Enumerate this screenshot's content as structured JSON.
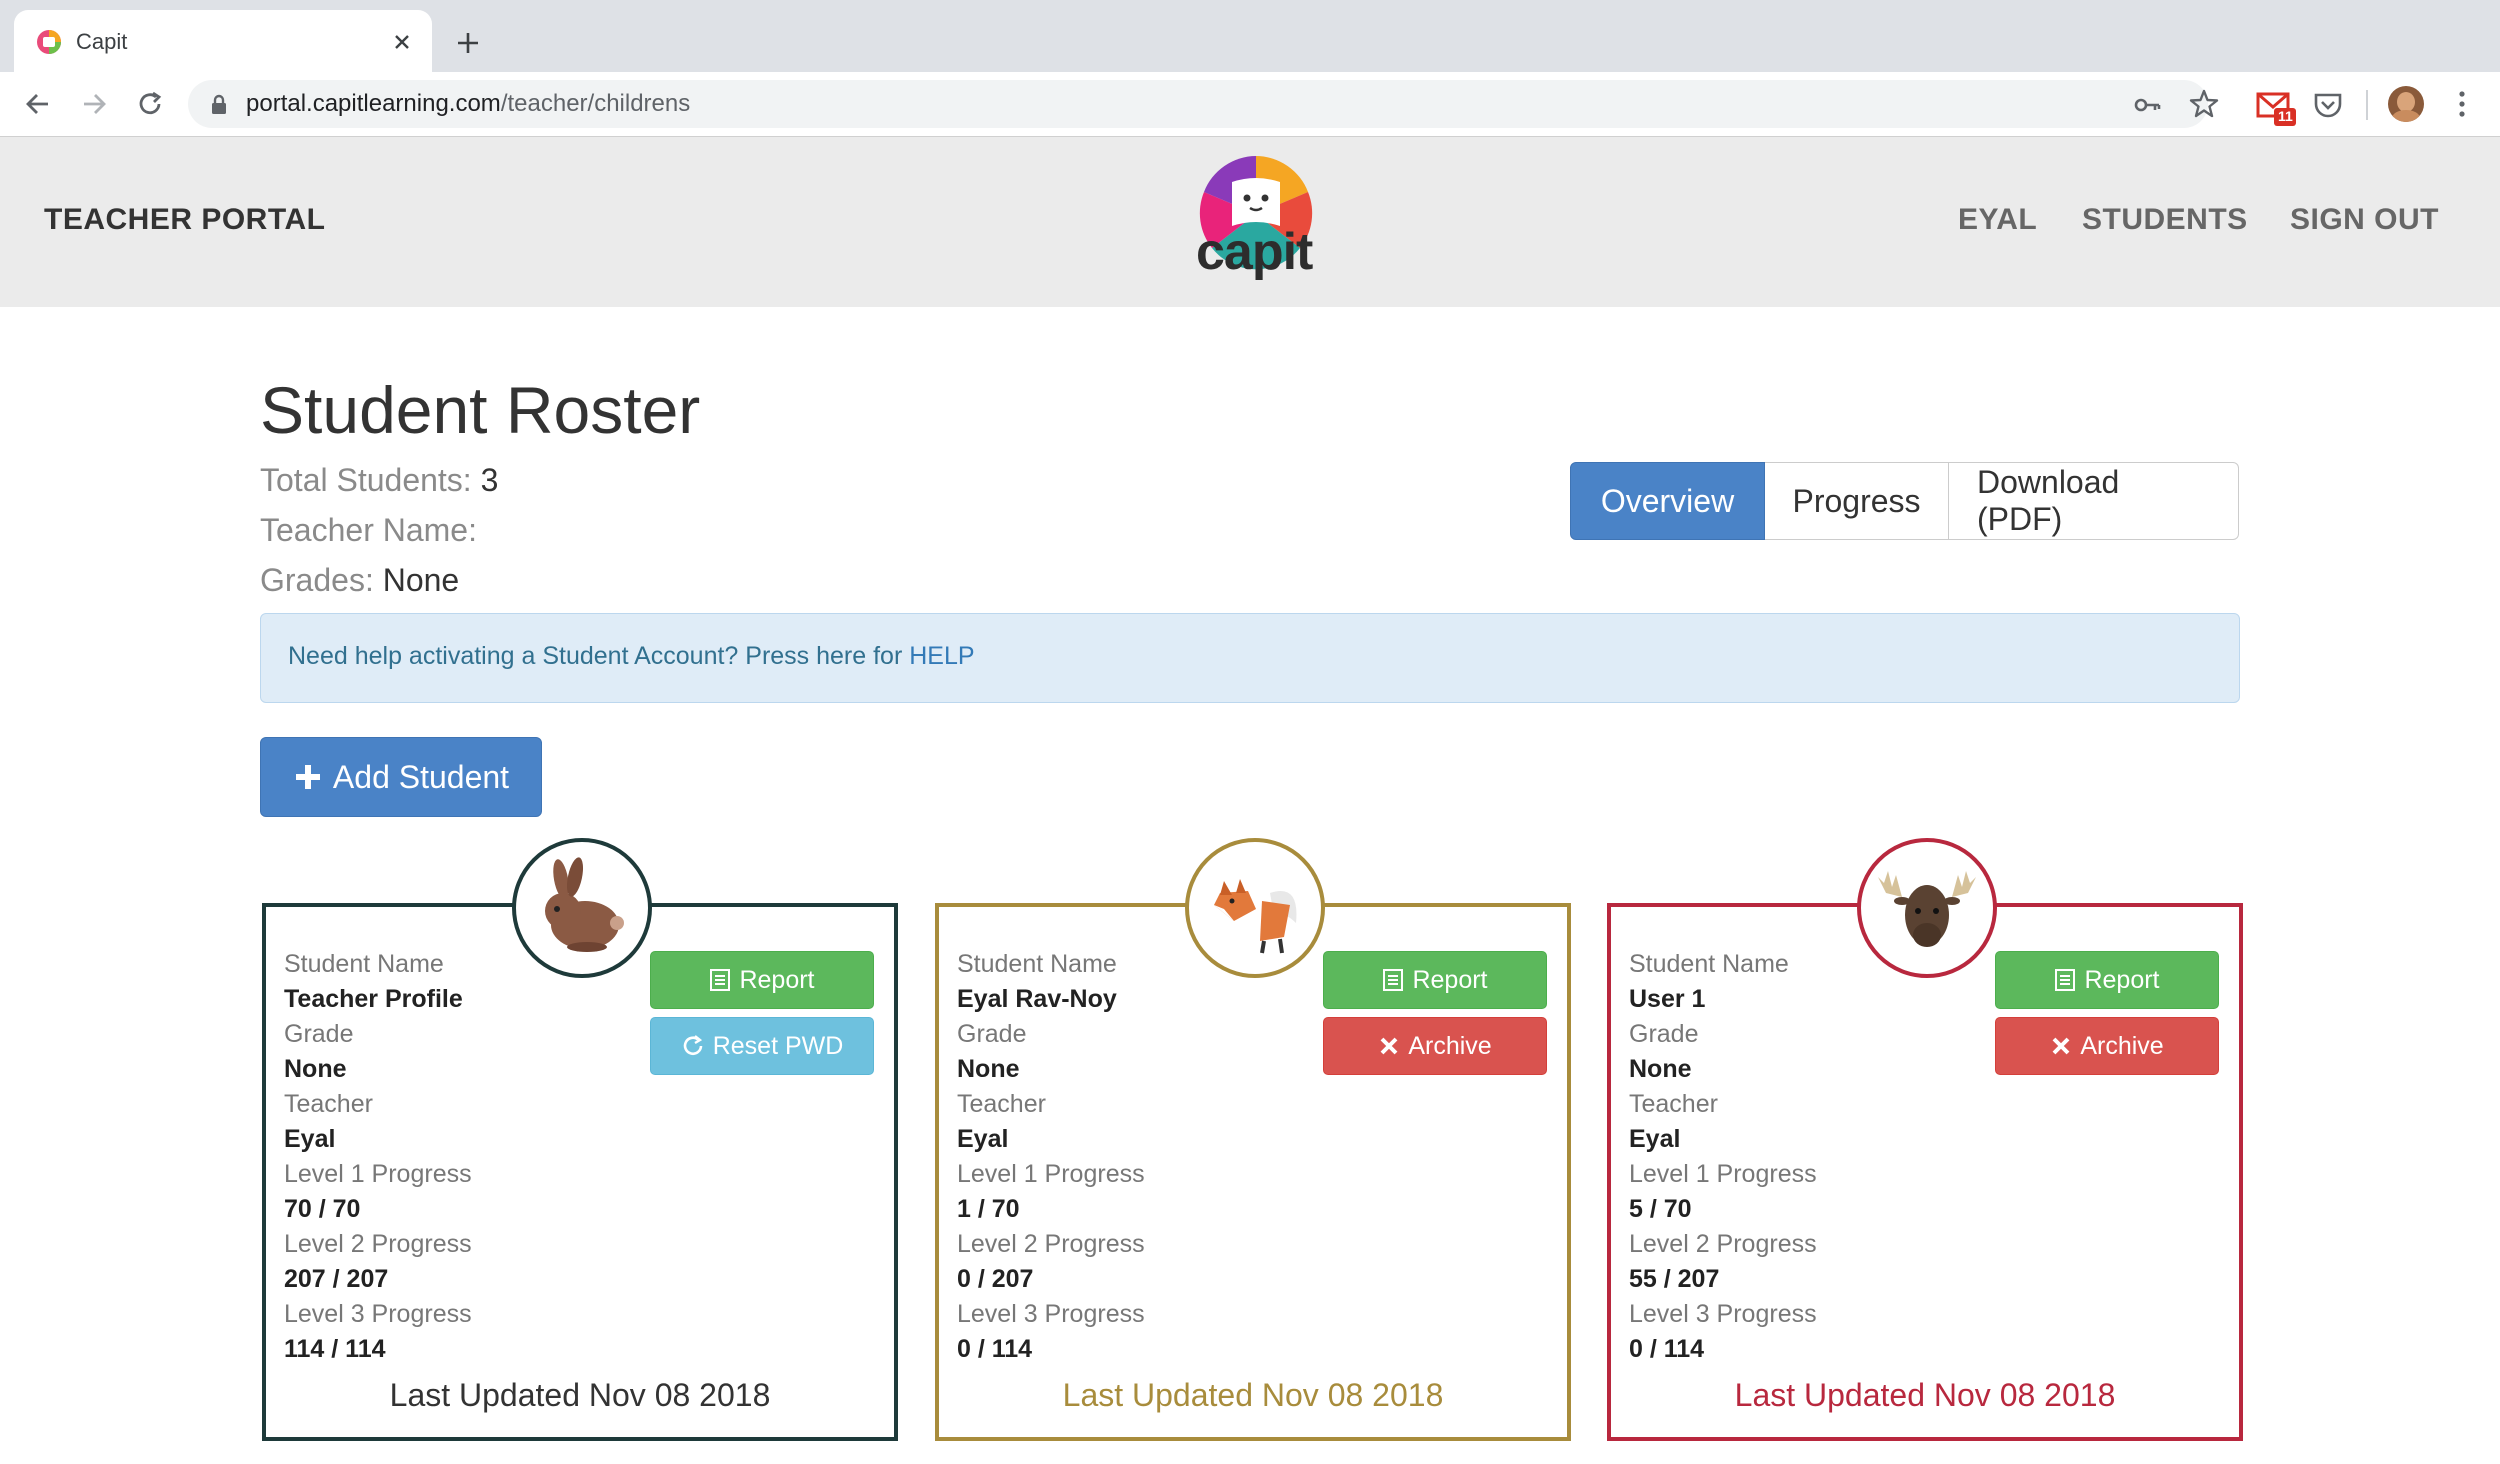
{
  "browser": {
    "tab_title": "Capit",
    "url_host": "portal.capitlearning.com",
    "url_path": "/teacher/childrens",
    "gmail_badge": "11"
  },
  "header": {
    "brand": "TEACHER PORTAL",
    "logo_text": "capit",
    "nav": [
      "EYAL",
      "STUDENTS",
      "SIGN OUT"
    ]
  },
  "roster": {
    "title": "Student Roster",
    "total_label": "Total Students:",
    "total_value": "3",
    "teacher_label": "Teacher Name:",
    "teacher_value": "",
    "grades_label": "Grades:",
    "grades_value": "None",
    "views": [
      "Overview",
      "Progress",
      "Download (PDF)"
    ],
    "help_text": "Need help activating a Student Account? Press here for ",
    "help_link": "HELP",
    "add_label": "Add Student"
  },
  "labels": {
    "student_name": "Student Name",
    "grade": "Grade",
    "teacher": "Teacher",
    "l1": "Level 1 Progress",
    "l2": "Level 2 Progress",
    "l3": "Level 3 Progress",
    "report": "Report",
    "reset": "Reset PWD",
    "archive": "Archive"
  },
  "students": [
    {
      "name": "Teacher Profile",
      "grade": "None",
      "teacher": "Eyal",
      "l1": "70 / 70",
      "l2": "207 / 207",
      "l3": "114 / 114",
      "updated": "Last Updated Nov 08 2018",
      "color": "#1e3a3a",
      "animal": "rabbit-icon"
    },
    {
      "name": "Eyal Rav-Noy",
      "grade": "None",
      "teacher": "Eyal",
      "l1": "1 / 70",
      "l2": "0 / 207",
      "l3": "0 / 114",
      "updated": "Last Updated Nov 08 2018",
      "color": "#a88c3c",
      "animal": "fox-icon"
    },
    {
      "name": "User 1",
      "grade": "None",
      "teacher": "Eyal",
      "l1": "5 / 70",
      "l2": "55 / 207",
      "l3": "0 / 114",
      "updated": "Last Updated Nov 08 2018",
      "color": "#b8283e",
      "animal": "moose-icon"
    }
  ]
}
